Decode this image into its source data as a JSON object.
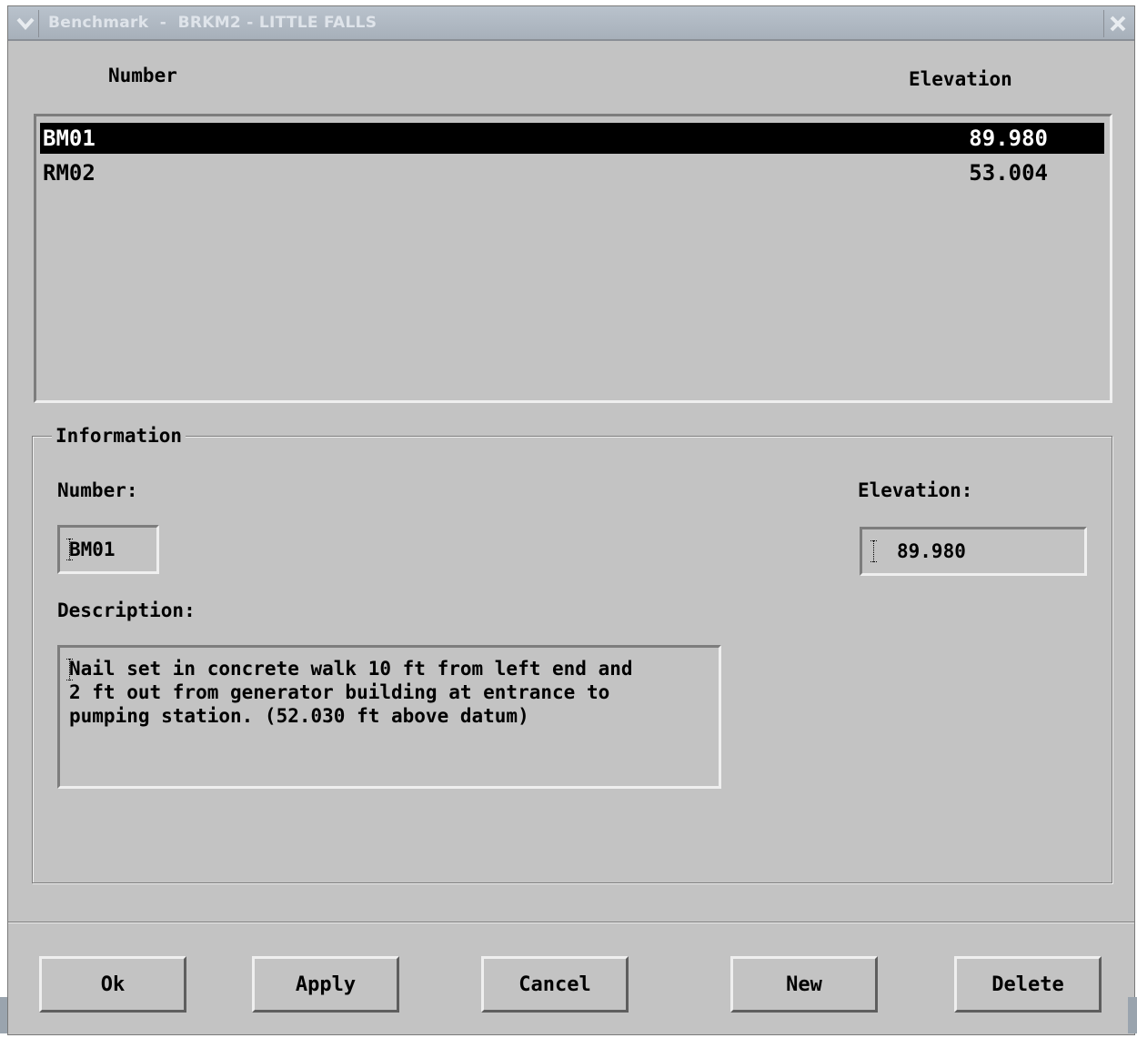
{
  "window": {
    "title": "Benchmark  -  BRKM2 - LITTLE FALLS",
    "menu_icon": "chevron-down-icon",
    "close_icon": "close-icon"
  },
  "list": {
    "header_number": "Number",
    "header_elevation": "Elevation",
    "rows": [
      {
        "number": "BM01",
        "elevation": "89.980",
        "selected": true
      },
      {
        "number": "RM02",
        "elevation": "53.004",
        "selected": false
      }
    ]
  },
  "information": {
    "legend": "Information",
    "number_label": "Number:",
    "number_value": "BM01",
    "elevation_label": "Elevation:",
    "elevation_value": "89.980",
    "description_label": "Description:",
    "description_value": "Nail set in concrete walk 10 ft from left end and\n2 ft out from generator building at entrance to\npumping station. (52.030 ft above datum)"
  },
  "buttons": {
    "ok": "Ok",
    "apply": "Apply",
    "cancel": "Cancel",
    "new": "New",
    "delete": "Delete"
  },
  "colors": {
    "window_bg": "#c3c3c3",
    "titlebar": "#a7b0ba",
    "selection": "#000000"
  }
}
